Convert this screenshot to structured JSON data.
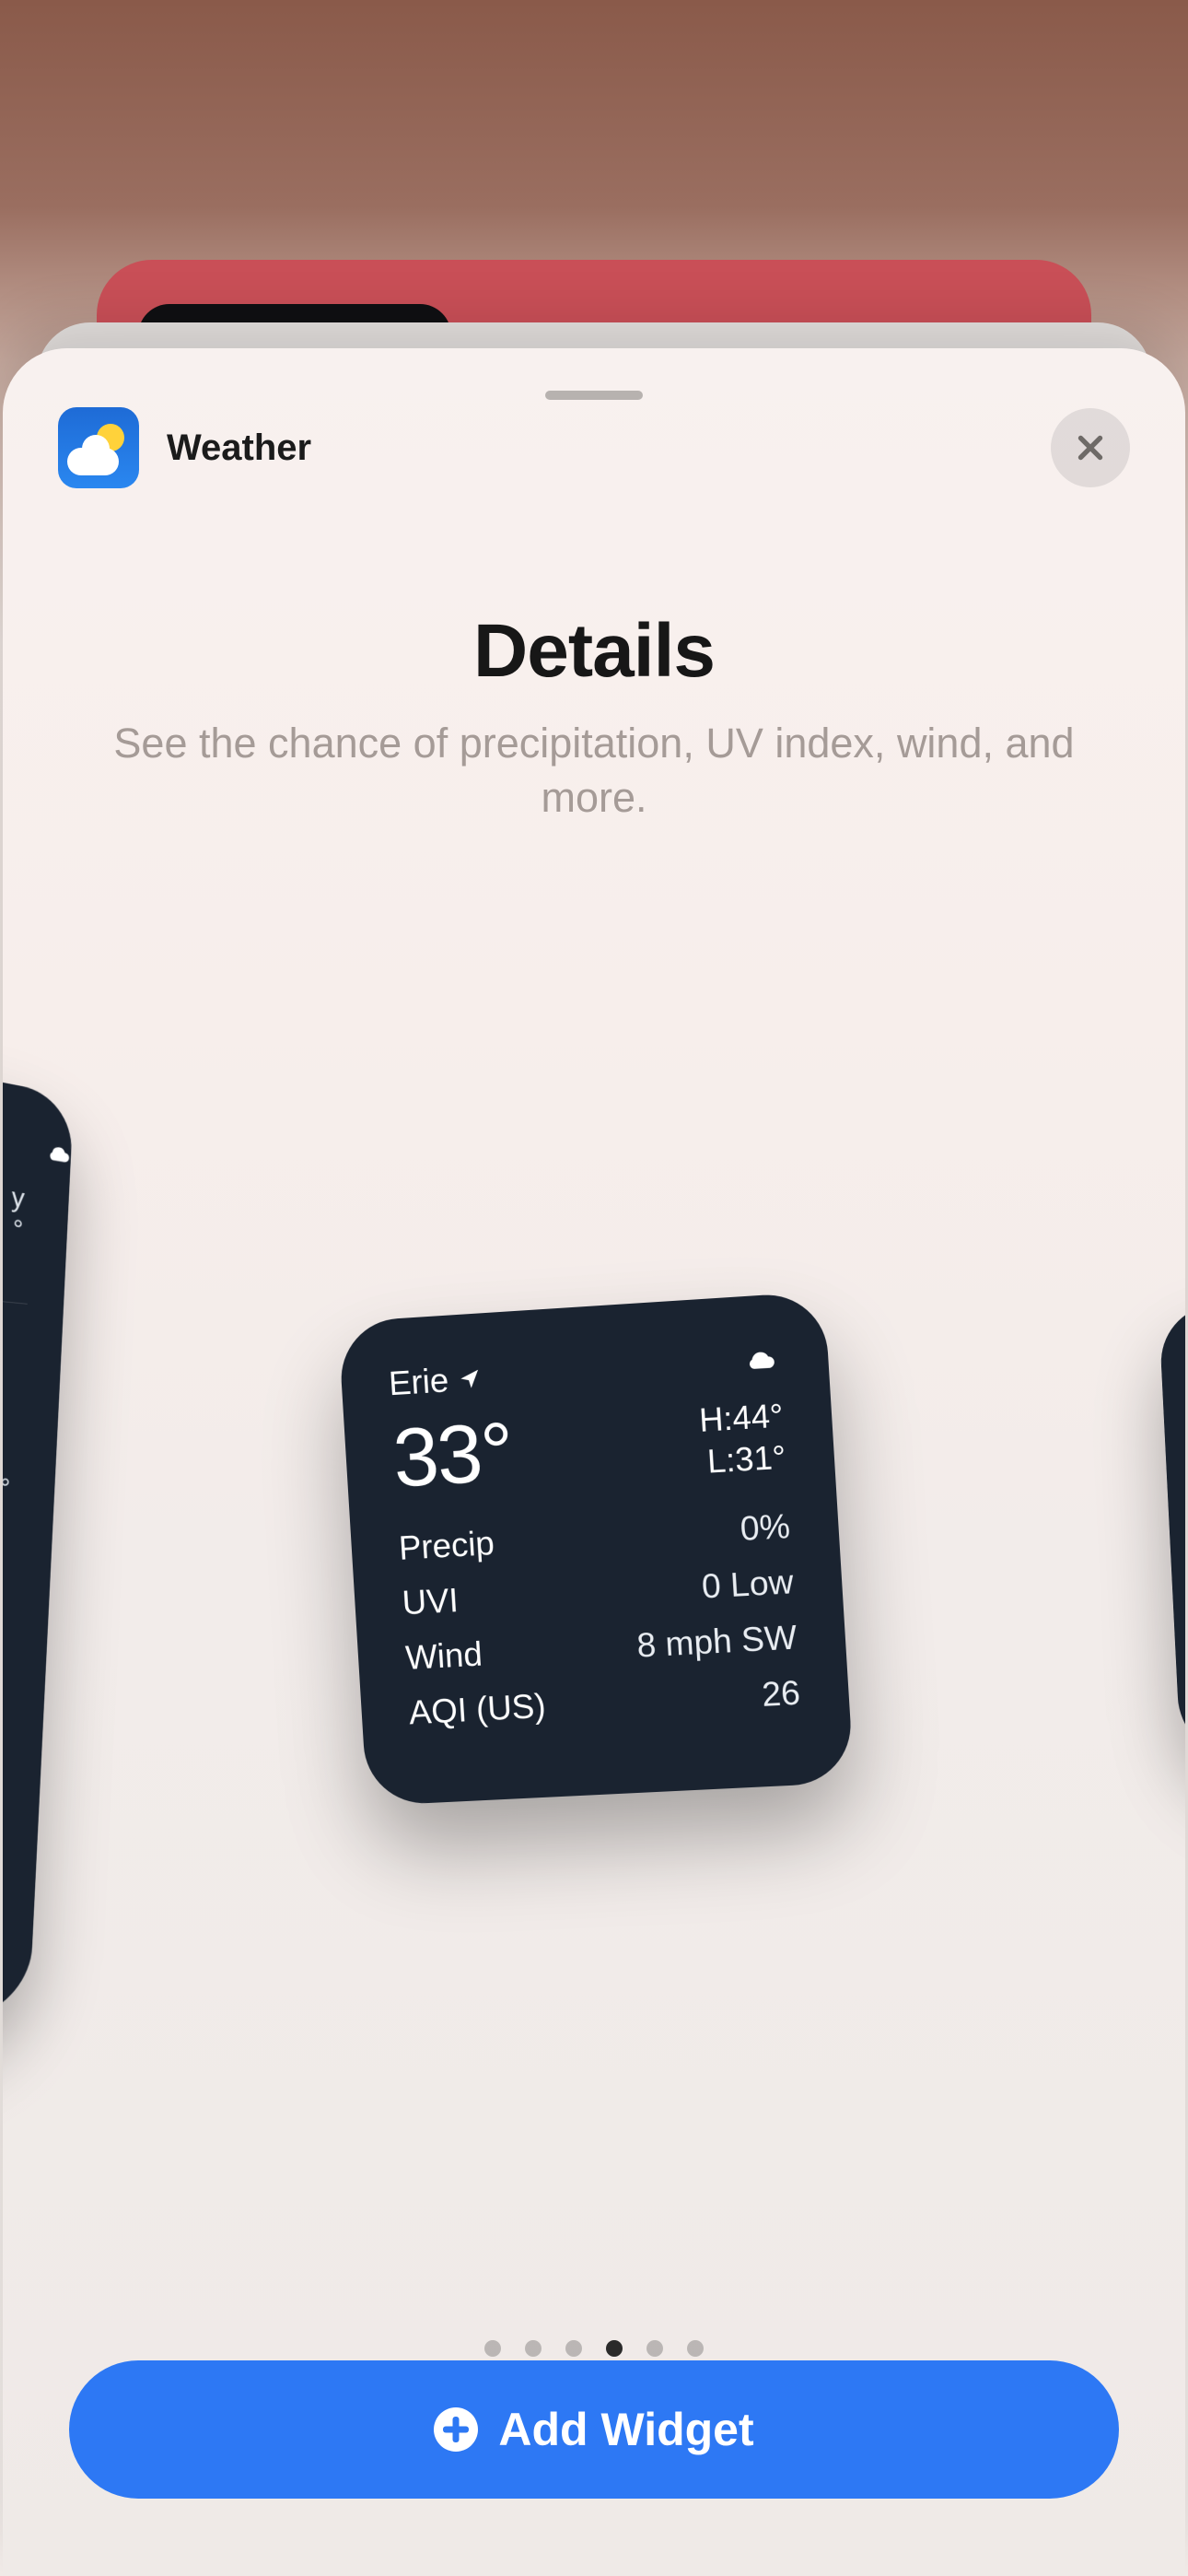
{
  "app": {
    "name": "Weather"
  },
  "page": {
    "title": "Details",
    "subtitle": "See the chance of precipitation, UV index, wind, and more."
  },
  "widget": {
    "location": "Erie",
    "temp": "33°",
    "high": "H:44°",
    "low": "L:31°",
    "rows": [
      {
        "label": "Precip",
        "value": "0%"
      },
      {
        "label": "UVI",
        "value": "0 Low"
      },
      {
        "label": "Wind",
        "value": "8 mph SW"
      },
      {
        "label": "AQI (US)",
        "value": "26"
      }
    ]
  },
  "pagination": {
    "count": 6,
    "active_index": 3
  },
  "cta": {
    "label": "Add Widget"
  },
  "colors": {
    "accent": "#2d78f4",
    "widget_bg": "#1a2330"
  }
}
